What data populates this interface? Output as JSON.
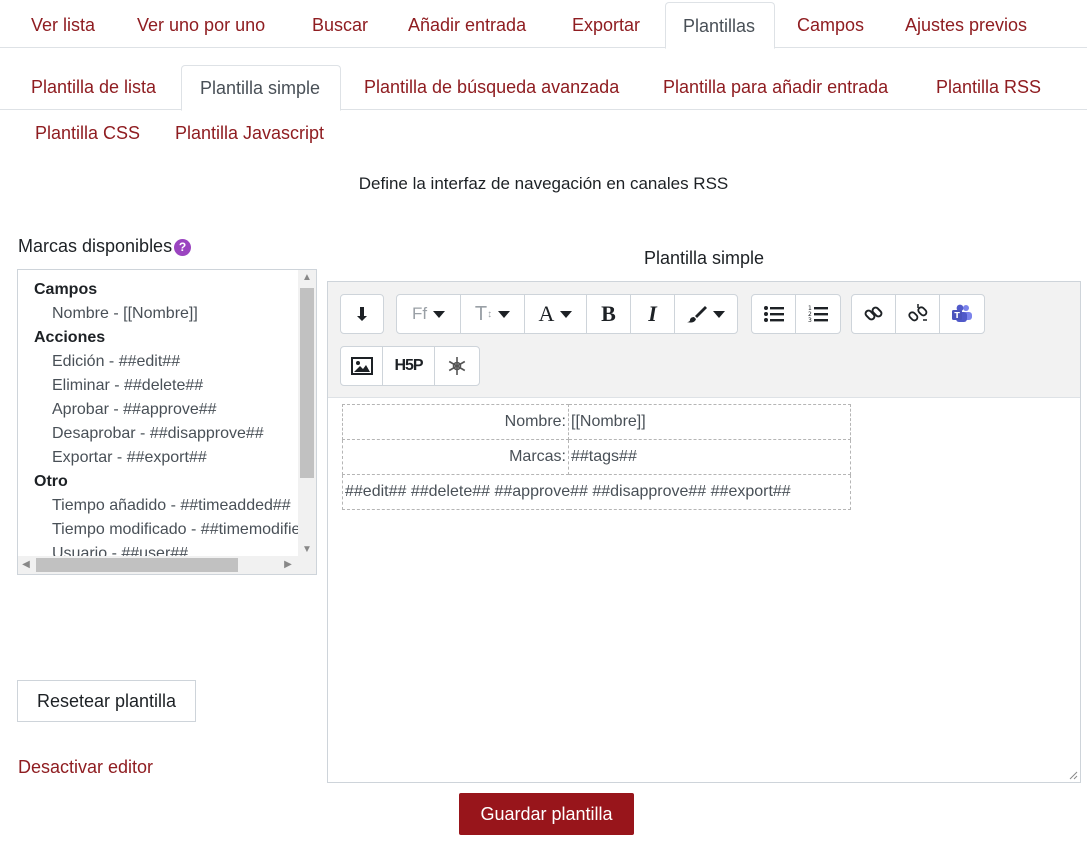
{
  "main_tabs": [
    "Ver lista",
    "Ver uno por uno",
    "Buscar",
    "Añadir entrada",
    "Exportar",
    "Plantillas",
    "Campos",
    "Ajustes previos"
  ],
  "sub_tabs": [
    "Plantilla de lista",
    "Plantilla simple",
    "Plantilla de búsqueda avanzada",
    "Plantilla para añadir entrada",
    "Plantilla RSS",
    "Plantilla CSS",
    "Plantilla Javascript"
  ],
  "description": "Define la interfaz de navegación en canales RSS",
  "marks": {
    "title": "Marcas disponibles",
    "help_icon": "question-circle-icon",
    "groups": [
      {
        "label": "Campos",
        "items": [
          "Nombre - [[Nombre]]"
        ]
      },
      {
        "label": "Acciones",
        "items": [
          "Edición - ##edit##",
          "Eliminar - ##delete##",
          "Aprobar - ##approve##",
          "Desaprobar - ##disapprove##",
          "Exportar - ##export##"
        ]
      },
      {
        "label": "Otro",
        "items": [
          "Tiempo añadido - ##timeadded##",
          "Tiempo modificado - ##timemodified##",
          "Usuario - ##user##"
        ]
      }
    ]
  },
  "reset_button": "Resetear plantilla",
  "disable_editor": "Desactivar editor",
  "editor": {
    "title": "Plantilla simple",
    "toolbar_icons": [
      "more-icon",
      "font-family-icon",
      "font-size-icon",
      "font-color-icon",
      "bold-icon",
      "italic-icon",
      "paintbrush-icon",
      "unordered-list-icon",
      "ordered-list-icon",
      "link-icon",
      "unlink-icon",
      "teams-icon",
      "image-icon",
      "h5p-icon",
      "snowflake-icon"
    ],
    "rows": [
      {
        "label": "Nombre:",
        "value": "[[Nombre]]"
      },
      {
        "label": "Marcas:",
        "value": "##tags##"
      }
    ],
    "actions_line": "##edit## ##delete## ##approve## ##disapprove## ##export##"
  },
  "save_button": "Guardar plantilla",
  "colors": {
    "accent": "#8f1d21",
    "save_bg": "#98151b",
    "help": "#9b44c0"
  }
}
